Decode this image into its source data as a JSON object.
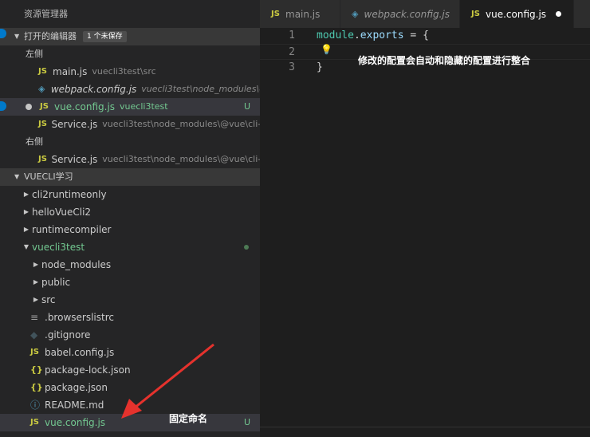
{
  "sidebar": {
    "title": "资源管理器",
    "open_editors": {
      "header": "打开的编辑器",
      "badge": "1 个未保存",
      "left_group": "左侧",
      "left_items": [
        {
          "name": "main.js",
          "path": "vuecli3test\\src"
        },
        {
          "name": "webpack.config.js",
          "path": "vuecli3test\\node_modules\\@..."
        },
        {
          "name": "vue.config.js",
          "path": "vuecli3test",
          "status": "U"
        },
        {
          "name": "Service.js",
          "path": "vuecli3test\\node_modules\\@vue\\cli-s..."
        }
      ],
      "right_group": "右侧",
      "right_items": [
        {
          "name": "Service.js",
          "path": "vuecli3test\\node_modules\\@vue\\cli-s..."
        }
      ]
    },
    "project": {
      "header": "VUECLI学习",
      "folders": [
        "cli2runtimeonly",
        "helloVueCli2",
        "runtimecompiler",
        "vuecli3test"
      ],
      "sub_folders": [
        "node_modules",
        "public",
        "src"
      ],
      "files": [
        ".browserslistrc",
        ".gitignore",
        "babel.config.js",
        "package-lock.json",
        "package.json",
        "README.md",
        "vue.config.js"
      ],
      "last_status": "U"
    }
  },
  "tabs": [
    {
      "label": "main.js",
      "icon": "JS"
    },
    {
      "label": "webpack.config.js",
      "icon": "webpack"
    },
    {
      "label": "vue.config.js",
      "icon": "JS"
    }
  ],
  "editor": {
    "line_numbers": [
      "1",
      "2",
      "3"
    ],
    "code": {
      "line1_kw": "module",
      "line1_dot": ".",
      "line1_prop": "exports",
      "line1_rest": " = {",
      "line3": "}"
    }
  },
  "annotations": {
    "merge_note": "修改的配置会自动和隐藏的配置进行整合",
    "fixed_name": "固定命名"
  },
  "colors": {
    "accent": "#007acc",
    "git_untracked": "#73c991",
    "annotation_arrow": "#e5322d"
  },
  "icons": {
    "js": "JS",
    "braces": "{}",
    "info": "ⓘ",
    "lines": "≡",
    "git": "◆",
    "webpack": "◈",
    "bulb": "💡"
  }
}
